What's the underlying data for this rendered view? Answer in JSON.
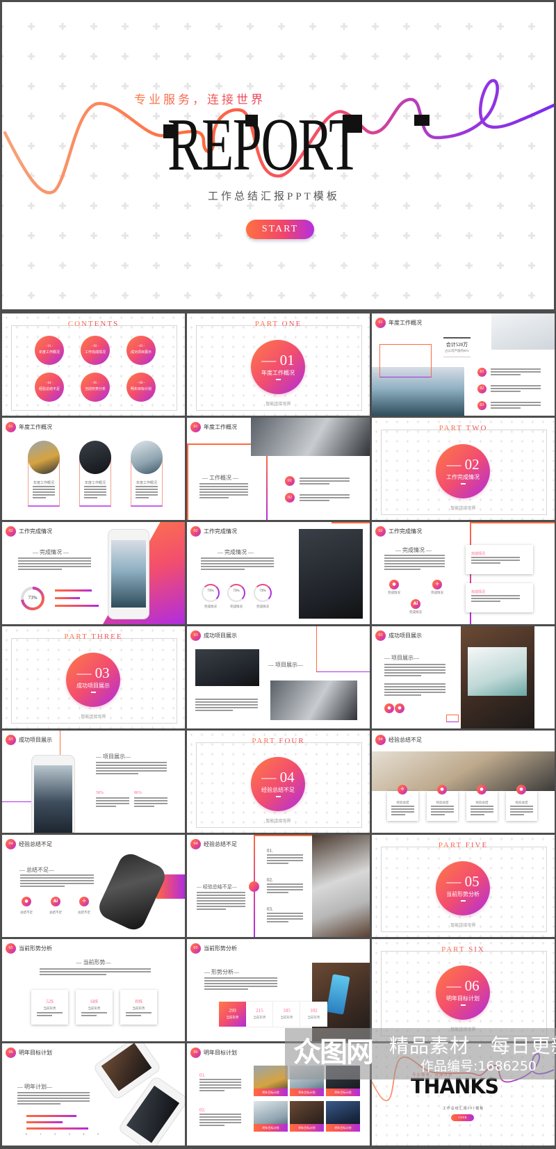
{
  "colors": {
    "accent_start": "#ff7a45",
    "accent_mid": "#f24e6e",
    "accent_end": "#b02ce0",
    "frame": "#4d4d4d"
  },
  "cover": {
    "tagline": "专业服务，连接世界",
    "title": "REPORT",
    "subtitle": "工作总结汇报PPT模板",
    "button": "START"
  },
  "contents": {
    "title": "CONTENTS",
    "items": [
      {
        "num": "- 01 -",
        "label": "年度工作概况"
      },
      {
        "num": "- 02 -",
        "label": "工作完成情况"
      },
      {
        "num": "- 03 -",
        "label": "成功项目展示"
      },
      {
        "num": "- 04 -",
        "label": "经验总结不足"
      },
      {
        "num": "- 05 -",
        "label": "当前形势分析"
      },
      {
        "num": "- 06 -",
        "label": "明年目标计划"
      }
    ]
  },
  "sections": [
    {
      "part": "PART ONE",
      "num": "— 01",
      "label": "年度工作概况",
      "footer": "智能连接世界"
    },
    {
      "part": "PART TWO",
      "num": "— 02",
      "label": "工作完成情况",
      "footer": "智能连接世界"
    },
    {
      "part": "PART THREE",
      "num": "— 03",
      "label": "成功项目展示",
      "footer": "智能连接世界"
    },
    {
      "part": "PART FOUR",
      "num": "— 04",
      "label": "经验总结不足",
      "footer": "智能连接世界"
    },
    {
      "part": "PART FIVE",
      "num": "— 05",
      "label": "当前形势分析",
      "footer": "智能连接世界"
    },
    {
      "part": "PART SIX",
      "num": "— 06",
      "label": "明年目标计划",
      "footer": "智能连接世界"
    }
  ],
  "slides": {
    "s3": {
      "badge": "01",
      "title": "年度工作概况",
      "stat": "合计520万",
      "stat_sub": "占公司产值的80%",
      "items": [
        "01",
        "02",
        "03"
      ]
    },
    "s4": {
      "badge": "01",
      "title": "年度工作概况",
      "captions": [
        "年度工作概况",
        "年度工作概况",
        "年度工作概况"
      ]
    },
    "s5": {
      "badge": "01",
      "title": "年度工作概况",
      "heading": "— 工作概况 —",
      "items": [
        "01",
        "02"
      ]
    },
    "s7": {
      "badge": "02",
      "title": "工作完成情况",
      "heading": "— 完成情况 —",
      "donut": "73%",
      "donut_value": 73,
      "bars": [
        0.75,
        0.52,
        0.9
      ]
    },
    "s8": {
      "badge": "02",
      "title": "工作完成情况",
      "heading": "— 完成情况 —",
      "rings": [
        {
          "value": "73%",
          "label": "完成情况"
        },
        {
          "value": "73%",
          "label": "完成情况"
        },
        {
          "value": "73%",
          "label": "完成情况"
        }
      ]
    },
    "s9": {
      "badge": "02",
      "title": "工作完成情况",
      "heading": "— 完成情况 —",
      "cards": [
        "完成情况",
        "完成情况"
      ],
      "icons": [
        {
          "icon": "location-pin-icon",
          "label": "完成情况"
        },
        {
          "icon": "share-icon",
          "label": "完成情况"
        },
        {
          "icon": "ai-icon",
          "glyph": "Ai",
          "label": "完成情况"
        }
      ]
    },
    "s11": {
      "badge": "03",
      "title": "成功项目展示",
      "heading": "— 项目展示—"
    },
    "s12": {
      "badge": "03",
      "title": "成功项目展示",
      "heading": "— 项目展示—"
    },
    "s13": {
      "badge": "03",
      "title": "成功项目展示",
      "heading": "— 项目展示—",
      "stats": [
        "58%",
        "86%"
      ]
    },
    "s15": {
      "badge": "04",
      "title": "经验总结不足",
      "cards": [
        "经验总结",
        "经验总结",
        "经验总结",
        "经验总结"
      ]
    },
    "s16": {
      "badge": "04",
      "title": "经验总结不足",
      "heading": "— 总结不足—",
      "icons": [
        {
          "icon": "location-pin-icon",
          "label": "总结不足"
        },
        {
          "icon": "ai-icon",
          "glyph": "Ai",
          "label": "总结不足"
        },
        {
          "icon": "share-icon",
          "label": "总结不足"
        }
      ]
    },
    "s17": {
      "badge": "04",
      "title": "经验总结不足",
      "heading": "— 经验总结不足—",
      "items": [
        "01.",
        "02.",
        "03."
      ]
    },
    "s19": {
      "badge": "05",
      "title": "当前形势分析",
      "heading": "— 当前形势—",
      "cards": [
        {
          "value": "52$",
          "label": "当前形势"
        },
        {
          "value": "68$",
          "label": "当前形势"
        },
        {
          "value": "89$",
          "label": "当前形势"
        }
      ]
    },
    "s20": {
      "badge": "05",
      "title": "当前形势分析",
      "heading": "— 形势分析—",
      "cells": [
        {
          "value": "299",
          "label": "当前形势"
        },
        {
          "value": "215",
          "label": "当前形势"
        },
        {
          "value": "185",
          "label": "当前形势"
        },
        {
          "value": "102",
          "label": "当前形势"
        }
      ]
    },
    "s22": {
      "badge": "06",
      "title": "明年目标计划",
      "heading": "— 明年计划—",
      "bars": [
        3.5,
        2.5,
        4.3
      ],
      "axis": [
        "0",
        "1",
        "2",
        "3",
        "4",
        "5"
      ]
    },
    "s23": {
      "badge": "06",
      "title": "明年目标计划",
      "items": [
        "01.",
        "02."
      ],
      "captions": [
        "明年目标计划",
        "明年目标计划",
        "明年目标计划",
        "明年目标计划",
        "明年目标计划",
        "明年目标计划"
      ]
    },
    "s24": {
      "tagline": "专业服务，连接世界",
      "title": "THANKS",
      "subtitle": "工作总结汇报PPT模板",
      "button": "OVER"
    }
  },
  "watermark": {
    "logo": "众图网",
    "line1": "精品素材 · 每日更新",
    "line2": "作品编号:1686250"
  }
}
